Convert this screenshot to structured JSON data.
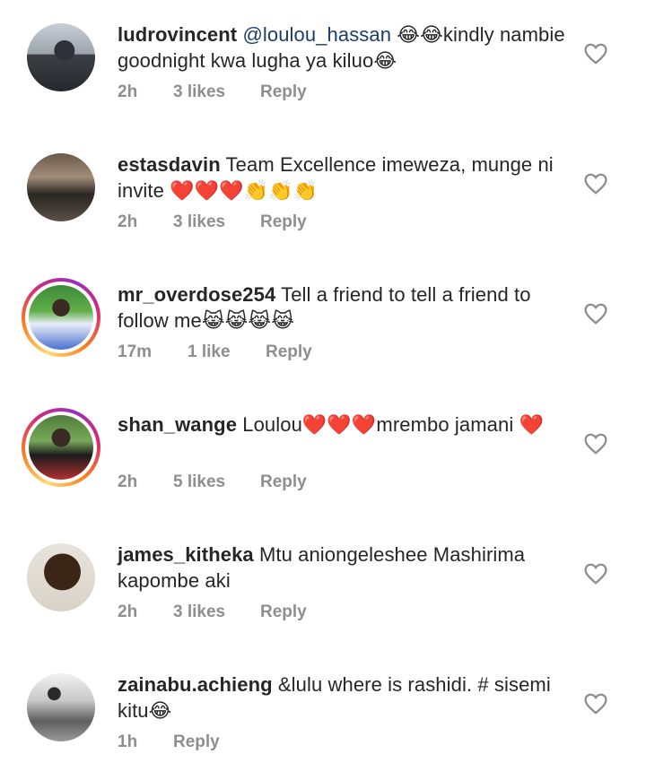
{
  "comments": [
    {
      "username": "ludrovincent",
      "mention": "@loulou_hassan",
      "text": " 😂😂kindly nambie goodnight kwa lugha ya kiluo😂",
      "time": "2h",
      "likes": "3 likes",
      "reply": "Reply",
      "has_story": false
    },
    {
      "username": "estasdavin",
      "mention": "",
      "text": " Team Excellence imeweza, munge ni invite ❤️❤️❤️👏👏👏",
      "time": "2h",
      "likes": "3 likes",
      "reply": "Reply",
      "has_story": false
    },
    {
      "username": "mr_overdose254",
      "mention": "",
      "text": " Tell a friend to tell a friend to follow me😹😹😹😹",
      "time": "17m",
      "likes": "1 like",
      "reply": "Reply",
      "has_story": true
    },
    {
      "username": "shan_wange",
      "mention": "",
      "text": " Loulou❤️❤️❤️mrembo jamani ❤️",
      "time": "2h",
      "likes": "5 likes",
      "reply": "Reply",
      "has_story": true
    },
    {
      "username": "james_kitheka",
      "mention": "",
      "text": " Mtu aniongeleshee Mashirima kapombe aki",
      "time": "2h",
      "likes": "3 likes",
      "reply": "Reply",
      "has_story": false
    },
    {
      "username": "zainabu.achieng",
      "mention": "",
      "text": " &lulu where is rashidi. # sisemi kitu😂",
      "time": "1h",
      "likes": "",
      "reply": "Reply",
      "has_story": false
    }
  ],
  "icons": {
    "like": "heart-outline-icon"
  },
  "colors": {
    "text": "#262626",
    "meta": "#8e8e8e",
    "mention": "#1b3d6e"
  }
}
